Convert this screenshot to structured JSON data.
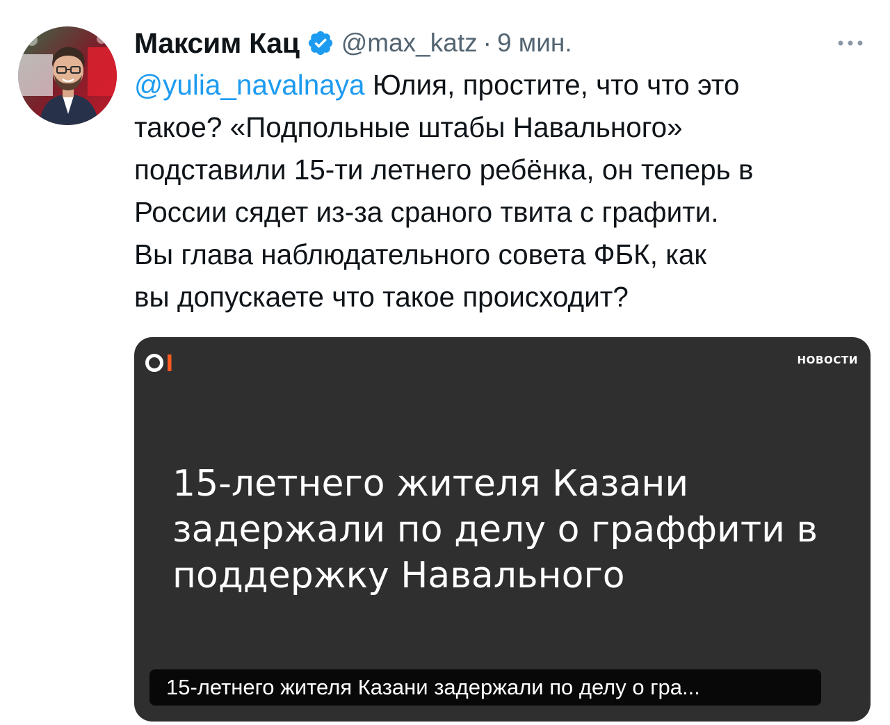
{
  "author": {
    "display_name": "Максим Кац",
    "handle": "@max_katz",
    "separator": "·",
    "timestamp": "9 мин.",
    "verified_color": "#1d9bf0"
  },
  "tweet": {
    "mention": "@yulia_navalnaya",
    "lines": [
      " Юлия, простите, что что это",
      "такое? «Подпольные штабы Навального»",
      "подставили 15-ти летнего ребёнка, он теперь в",
      "России сядет из-за сраного твита с графити.",
      "Вы глава наблюдательного совета ФБК, как",
      "вы допускаете что такое происходит?"
    ]
  },
  "media": {
    "logo_color": "#ff5a1f",
    "tag": "НОВОСТИ",
    "headline_lines": [
      "15-летнего жителя Казани",
      "задержали по делу о граффити в",
      "поддержку Навального"
    ],
    "caption": "15-летнего жителя Казани задержали по делу о гра..."
  },
  "colors": {
    "text": "#0f1419",
    "secondary": "#536471",
    "link": "#1d9bf0",
    "card_bg": "#2f2f2f"
  },
  "icons": {
    "verified": "verified-badge-icon",
    "more": "more-horizontal-icon"
  }
}
